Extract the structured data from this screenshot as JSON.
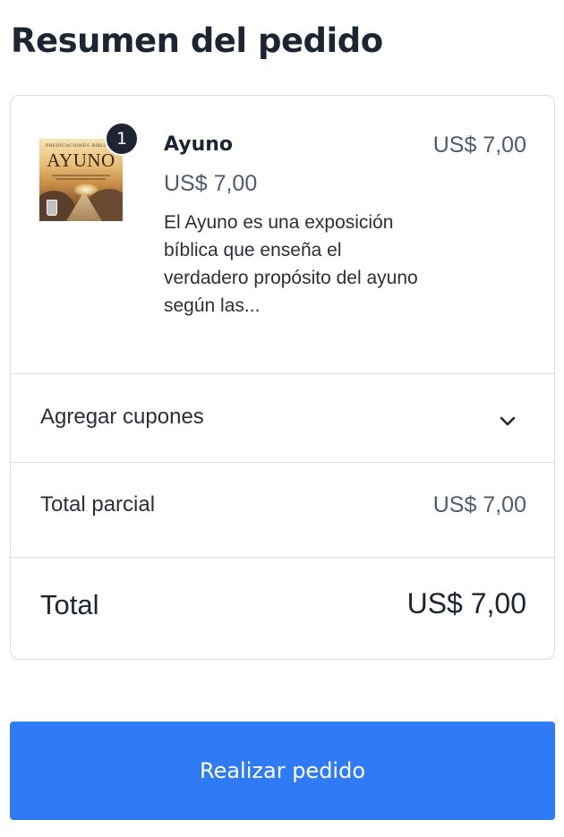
{
  "page": {
    "title": "Resumen del pedido"
  },
  "product": {
    "quantity": "1",
    "cover_kicker": "PREDICACIONES BÍBLICAS",
    "cover_title": "AYUNO",
    "name": "Ayuno",
    "unit_price": "US$ 7,00",
    "line_total": "US$ 7,00",
    "description": "El Ayuno es una exposición bíblica que enseña el verdadero propósito del ayuno según las..."
  },
  "coupons": {
    "label": "Agregar cupones",
    "icon": "chevron-down-icon"
  },
  "subtotal": {
    "label": "Total parcial",
    "value": "US$ 7,00"
  },
  "total": {
    "label": "Total",
    "value": "US$ 7,00"
  },
  "actions": {
    "place_order_label": "Realizar pedido"
  },
  "colors": {
    "primary_button": "#2f7bf5",
    "badge": "#1e2431",
    "border": "#d9dce1",
    "muted_text": "#4f5b6f"
  }
}
